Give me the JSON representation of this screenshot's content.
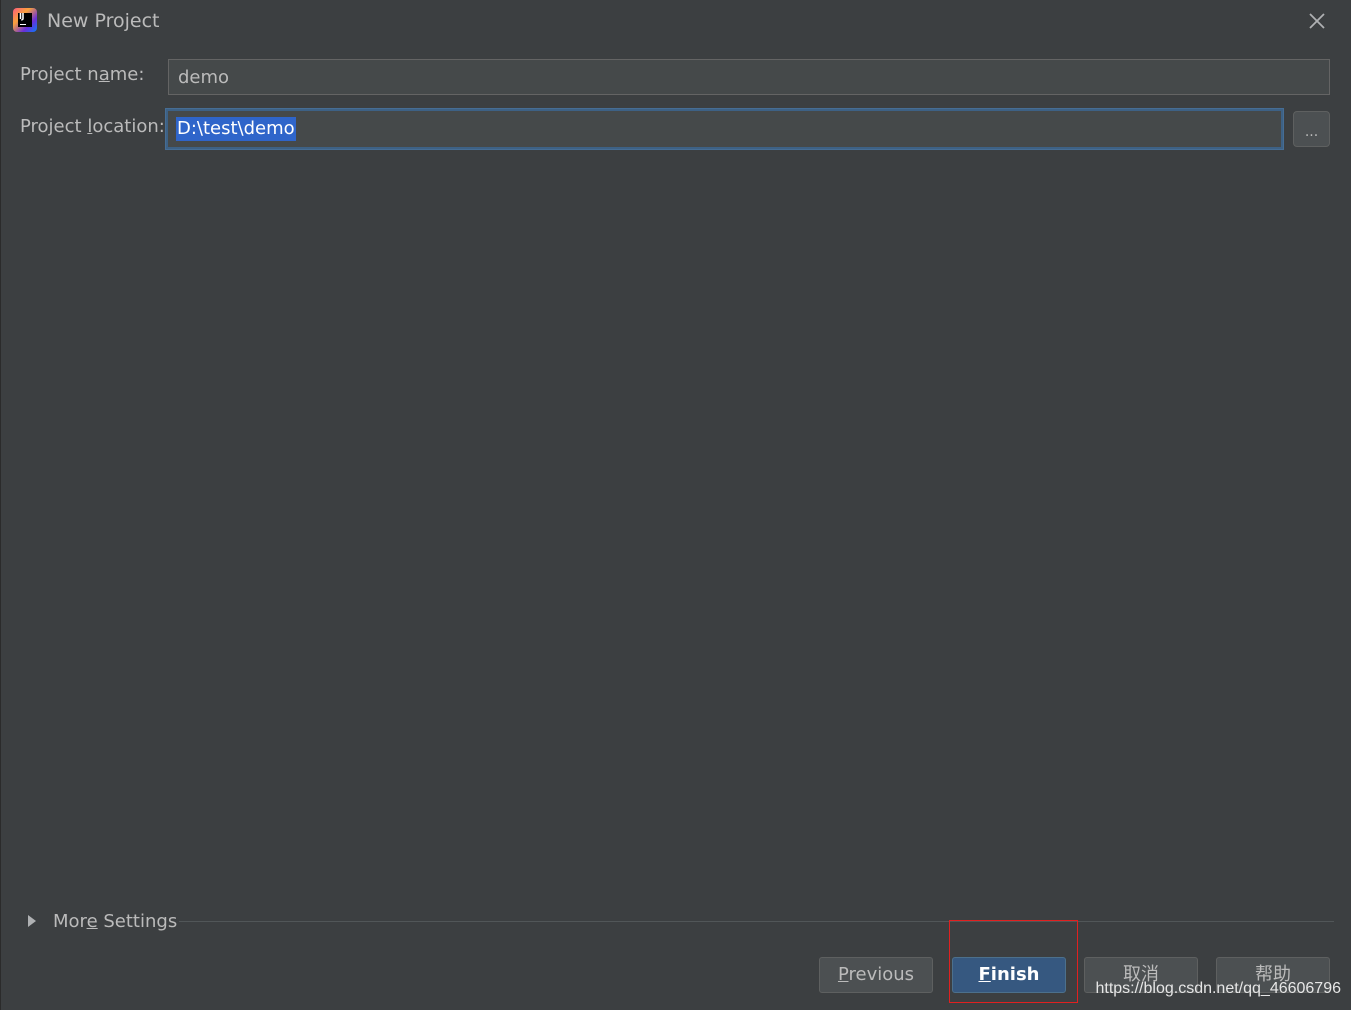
{
  "window": {
    "title": "New Project",
    "app_icon": "intellij-idea-icon",
    "close_icon": "close-icon"
  },
  "form": {
    "project_name": {
      "label_pre": "Project n",
      "label_mnemonic": "a",
      "label_post": "me:",
      "value": "demo"
    },
    "project_location": {
      "label_pre": "Project ",
      "label_mnemonic": "l",
      "label_post": "ocation:",
      "value": "D:\\test\\demo",
      "browse_label": "..."
    }
  },
  "more_settings": {
    "label_pre": "Mor",
    "label_mnemonic": "e",
    "label_post": " Settings",
    "expand_icon": "triangle-right-icon"
  },
  "buttons": {
    "previous": {
      "mnemonic": "P",
      "rest": "revious"
    },
    "finish": {
      "mnemonic": "F",
      "rest": "inish"
    },
    "cancel": "取消",
    "help": "帮助"
  },
  "watermark": "https://blog.csdn.net/qq_46606796",
  "colors": {
    "background": "#3c3f41",
    "field_background": "#45494a",
    "selection": "#2f65ca",
    "primary_button": "#365880",
    "highlight_box": "#e02020"
  }
}
